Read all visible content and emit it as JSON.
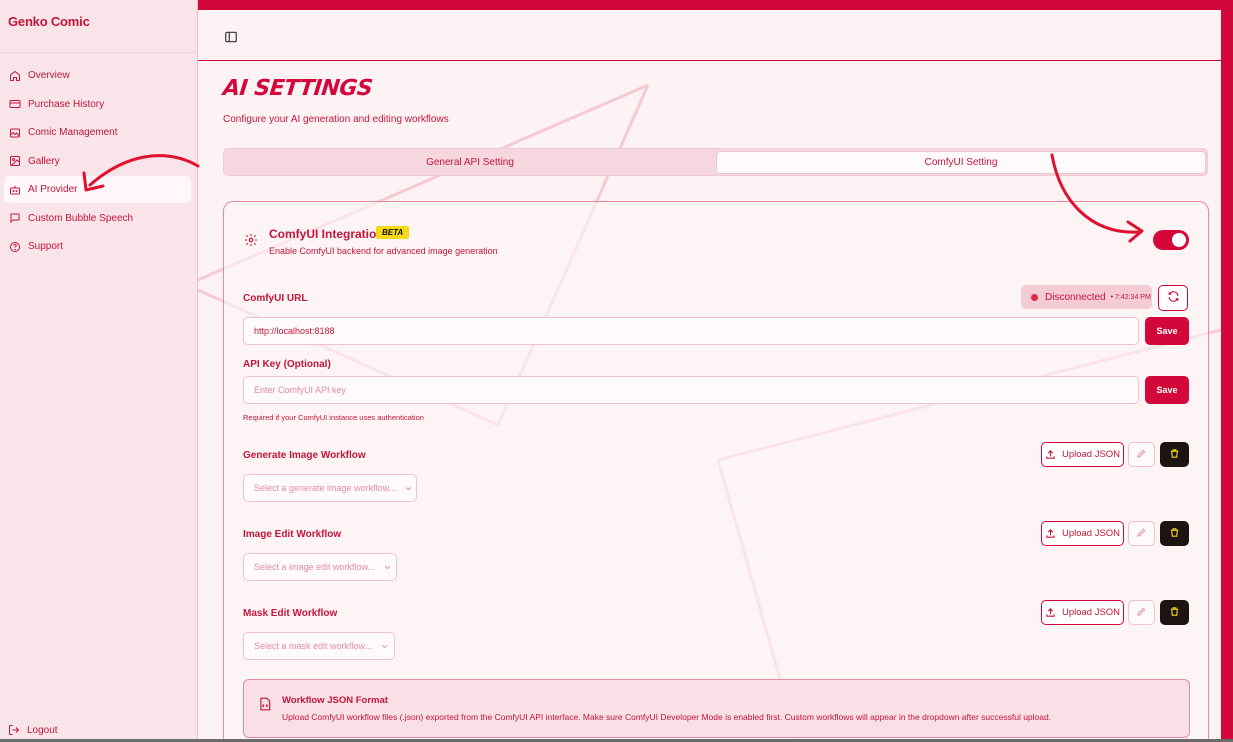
{
  "brand": "Genko Comic",
  "sidebar": {
    "items": [
      {
        "label": "Overview",
        "icon": "home-icon"
      },
      {
        "label": "Purchase History",
        "icon": "receipt-icon"
      },
      {
        "label": "Comic Management",
        "icon": "image-stack-icon"
      },
      {
        "label": "Gallery",
        "icon": "image-icon"
      },
      {
        "label": "AI Provider",
        "icon": "bot-icon",
        "active": true
      },
      {
        "label": "Custom Bubble Speech",
        "icon": "speech-bubble-icon"
      },
      {
        "label": "Support",
        "icon": "help-circle-icon"
      }
    ],
    "logout_label": "Logout"
  },
  "page": {
    "title": "AI SETTINGS",
    "subtitle": "Configure your AI generation and editing workflows"
  },
  "tabs": [
    {
      "label": "General API Setting",
      "active": false
    },
    {
      "label": "ComfyUI Setting",
      "active": true
    }
  ],
  "integration": {
    "title": "ComfyUI Integration",
    "badge": "BETA",
    "subtitle": "Enable ComfyUI backend for advanced image generation",
    "enabled": true
  },
  "comfy_url": {
    "label": "ComfyUI URL",
    "value": "http://localhost:8188",
    "status": "Disconnected",
    "status_time": "• 7:42:34 PM",
    "save_label": "Save"
  },
  "api_key": {
    "label": "API Key (Optional)",
    "placeholder": "Enter ComfyUI API key",
    "hint": "Required if your ComfyUI instance uses authentication",
    "save_label": "Save"
  },
  "workflows": [
    {
      "label": "Generate Image Workflow",
      "select_placeholder": "Select a generate image workflow...",
      "upload_label": "Upload JSON"
    },
    {
      "label": "Image Edit Workflow",
      "select_placeholder": "Select a image edit workflow...",
      "upload_label": "Upload JSON"
    },
    {
      "label": "Mask Edit Workflow",
      "select_placeholder": "Select a mask edit workflow...",
      "upload_label": "Upload JSON"
    }
  ],
  "info": {
    "title": "Workflow JSON Format",
    "text": "Upload ComfyUI workflow files (.json) exported from the ComfyUI API interface. Make sure ComfyUI Developer Mode is enabled first. Custom workflows will appear in the dropdown after successful upload."
  },
  "colors": {
    "accent": "#d4073a",
    "sidebar_bg": "#f9e4e9",
    "beta_bg": "#f7d81b",
    "status_bg": "#f5cbd6"
  }
}
